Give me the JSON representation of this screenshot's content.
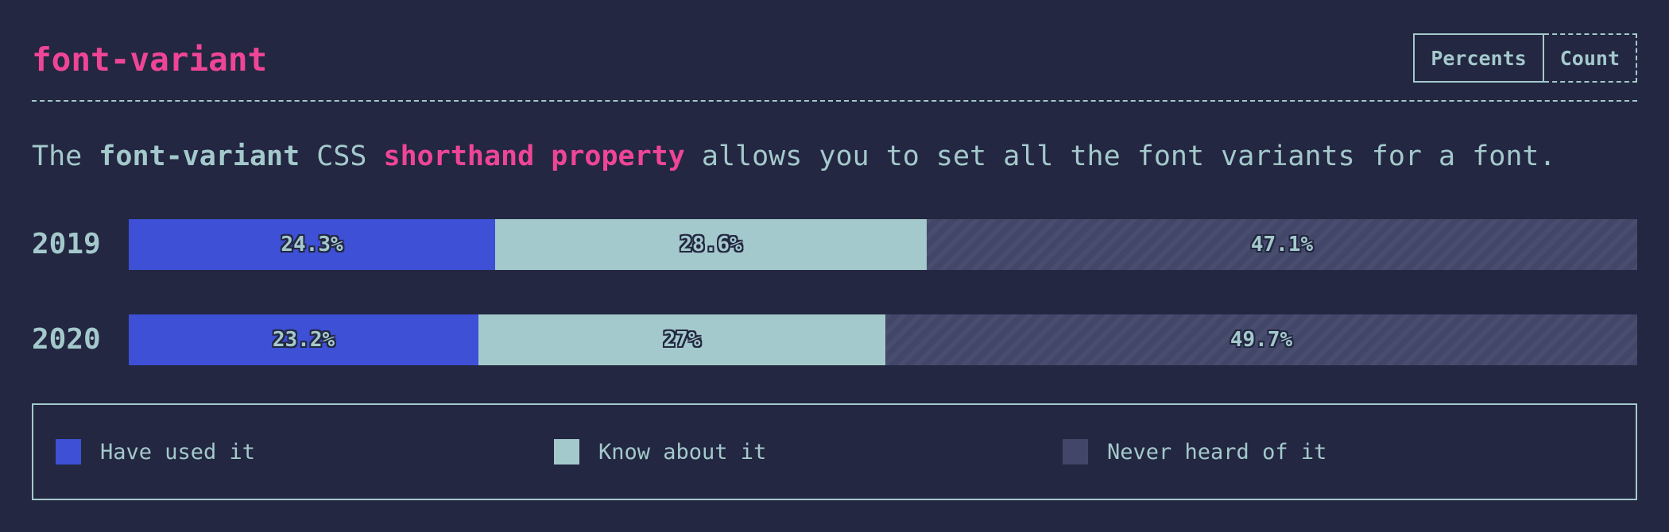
{
  "header": {
    "title": "font-variant",
    "toggle": {
      "percents_label": "Percents",
      "count_label": "Count",
      "active": "Percents"
    }
  },
  "description": {
    "part1": "The ",
    "code": "font-variant",
    "part2": " CSS ",
    "highlight": "shorthand property",
    "part3": " allows you to set all the font variants for a font."
  },
  "colors": {
    "background": "#232741",
    "accent": "#ef4597",
    "text": "#a4c9cc",
    "used": "#3d50d6",
    "know": "#a4c9cc",
    "never": "#424769"
  },
  "chart_data": {
    "type": "bar",
    "orientation": "horizontal",
    "stacked": true,
    "normalized": true,
    "categories": [
      "2019",
      "2020"
    ],
    "series": [
      {
        "name": "Have used it",
        "values": [
          24.3,
          23.2
        ],
        "labels": [
          "24.3%",
          "23.2%"
        ]
      },
      {
        "name": "Know about it",
        "values": [
          28.6,
          27
        ],
        "labels": [
          "28.6%",
          "27%"
        ]
      },
      {
        "name": "Never heard of it",
        "values": [
          47.1,
          49.7
        ],
        "labels": [
          "47.1%",
          "49.7%"
        ]
      }
    ],
    "xlim": [
      0,
      100
    ],
    "legend": "bottom"
  }
}
